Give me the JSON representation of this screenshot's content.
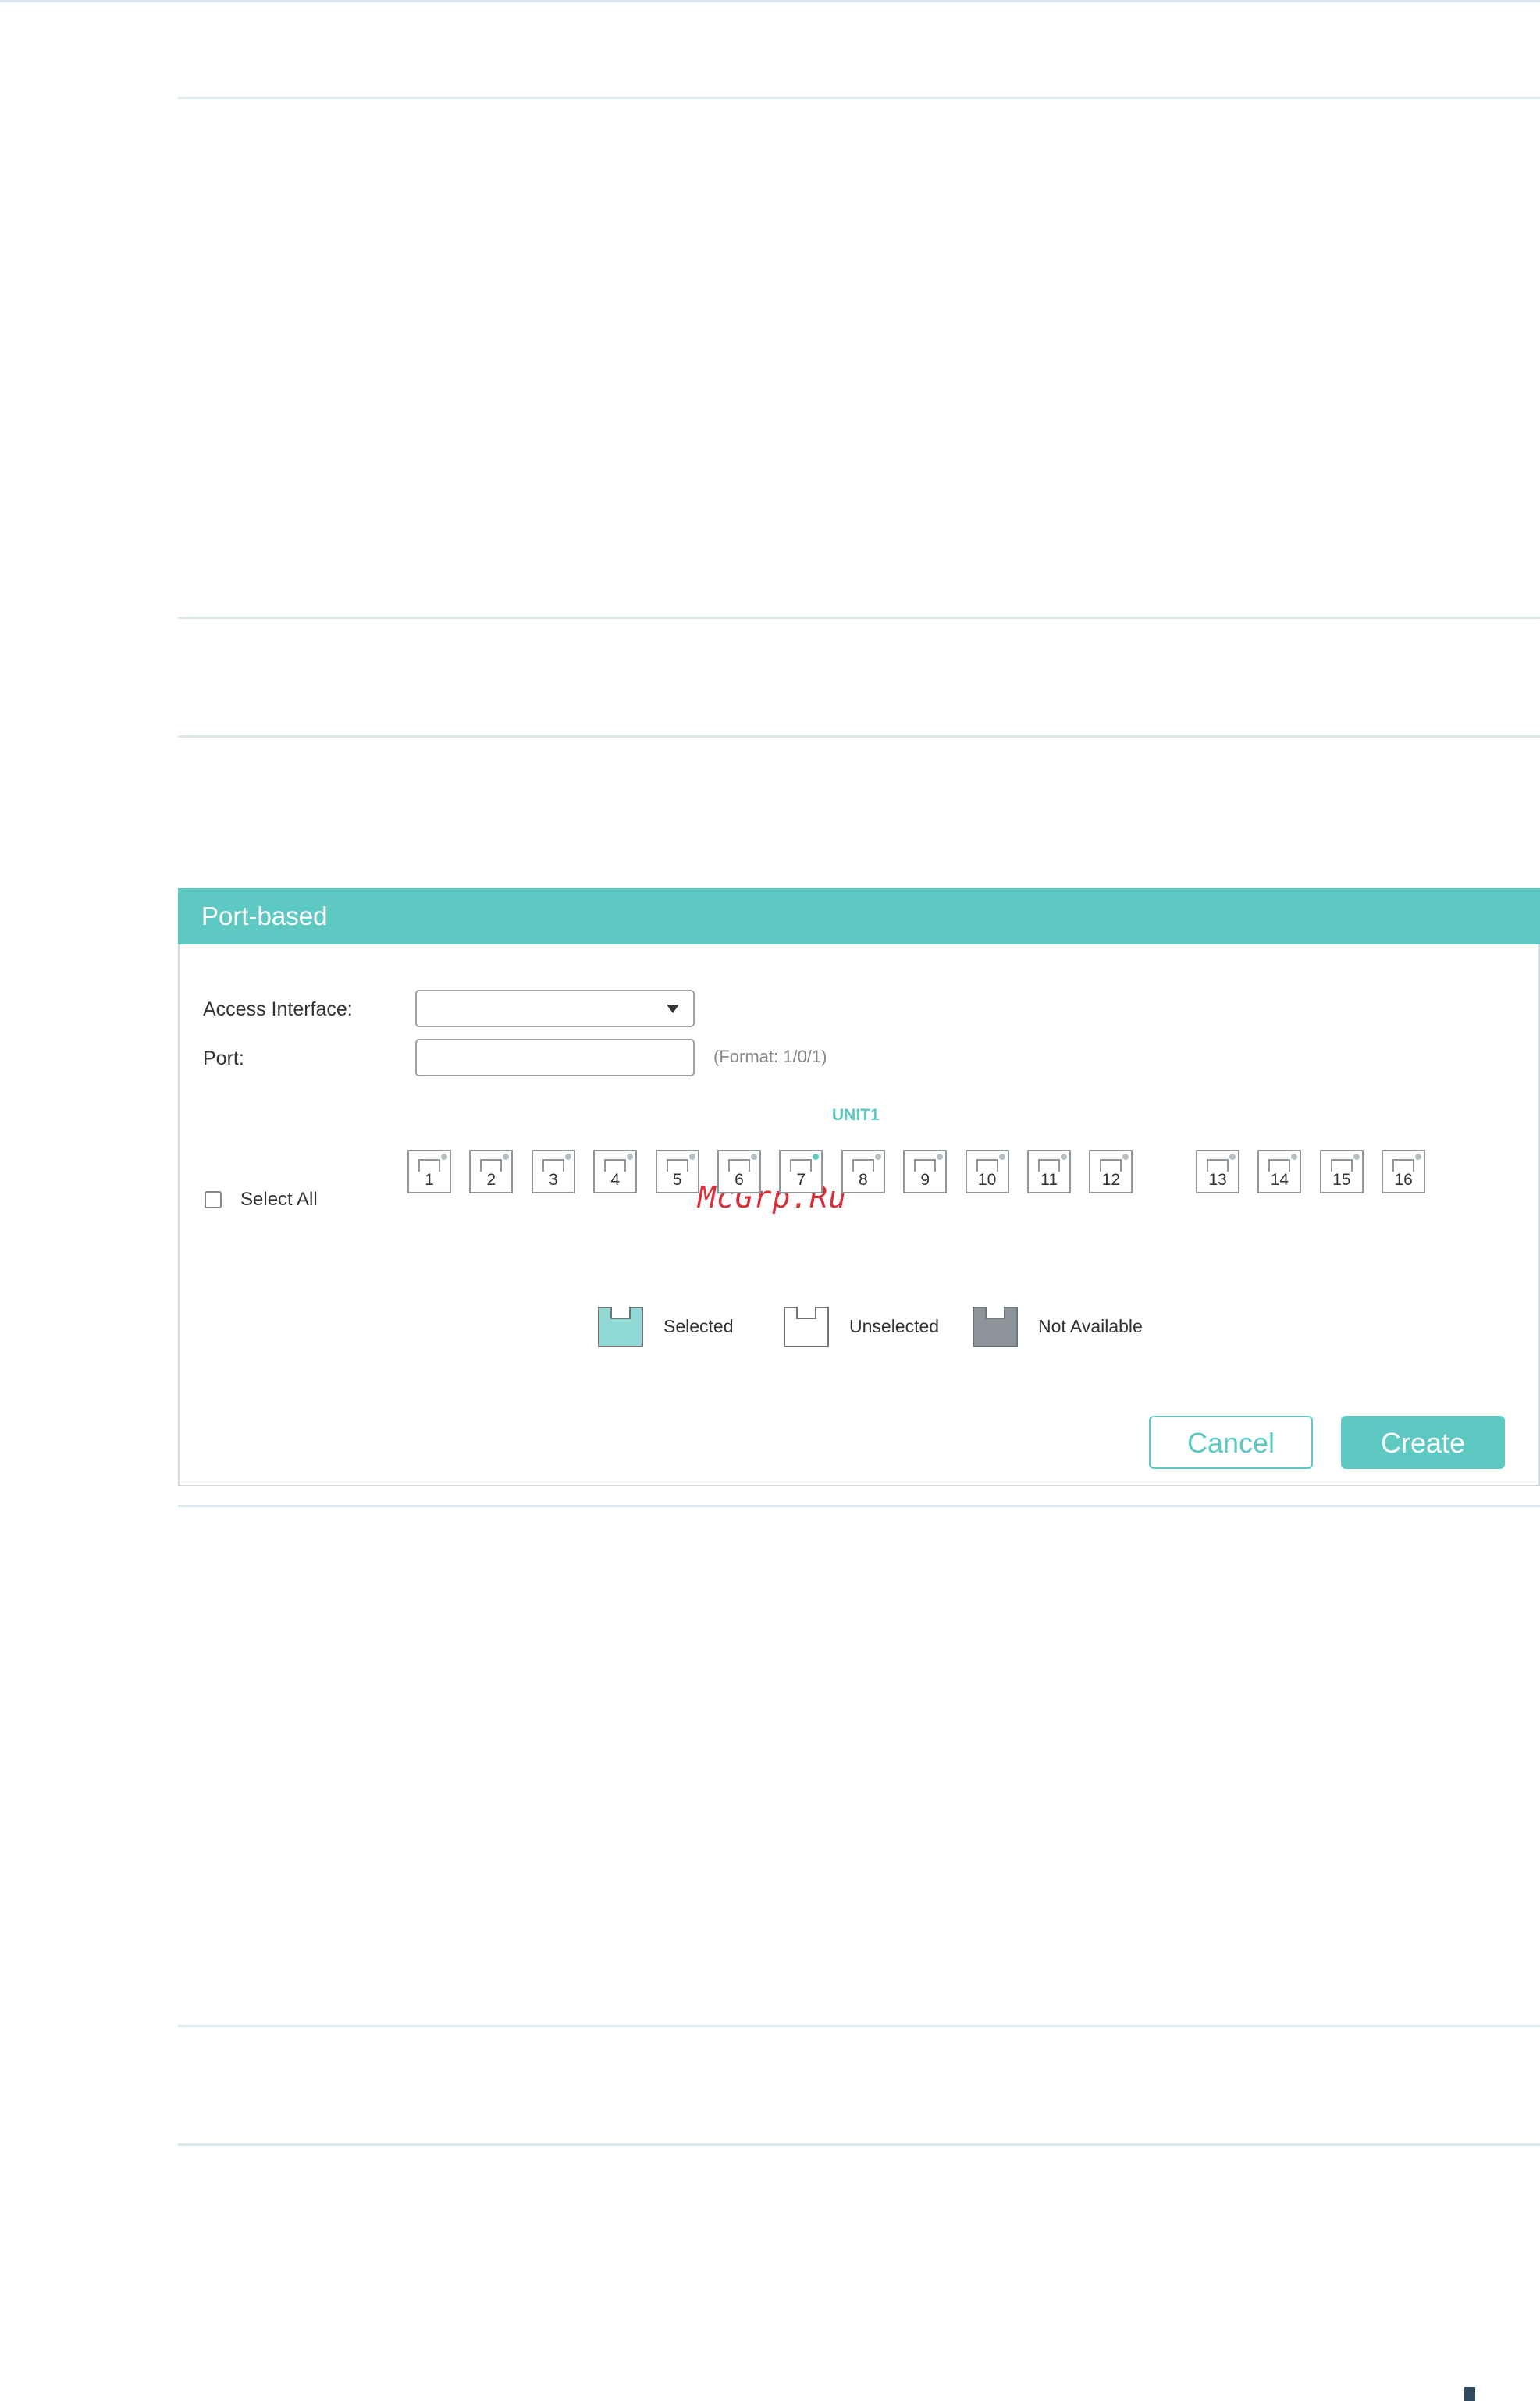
{
  "dialog": {
    "title": "Port-based",
    "access_interface_label": "Access Interface:",
    "access_interface_value": "",
    "port_label": "Port:",
    "port_value": "",
    "port_hint": "(Format: 1/0/1)",
    "unit_label": "UNIT1",
    "select_all_label": "Select All",
    "select_all_checked": false,
    "ports": [
      {
        "number": "1",
        "active": false
      },
      {
        "number": "2",
        "active": false
      },
      {
        "number": "3",
        "active": false
      },
      {
        "number": "4",
        "active": false
      },
      {
        "number": "5",
        "active": false
      },
      {
        "number": "6",
        "active": false
      },
      {
        "number": "7",
        "active": true
      },
      {
        "number": "8",
        "active": false
      },
      {
        "number": "9",
        "active": false
      },
      {
        "number": "10",
        "active": false
      },
      {
        "number": "11",
        "active": false
      },
      {
        "number": "12",
        "active": false
      },
      {
        "number": "13",
        "active": false
      },
      {
        "number": "14",
        "active": false
      },
      {
        "number": "15",
        "active": false
      },
      {
        "number": "16",
        "active": false
      }
    ],
    "legend": {
      "selected": "Selected",
      "unselected": "Unselected",
      "not_available": "Not Available"
    },
    "cancel_label": "Cancel",
    "create_label": "Create"
  },
  "watermark": "McGrp.Ru",
  "colors": {
    "accent": "#5ec9c3",
    "selected_fill": "#8fd8d4",
    "unavailable_fill": "#8e9499"
  }
}
